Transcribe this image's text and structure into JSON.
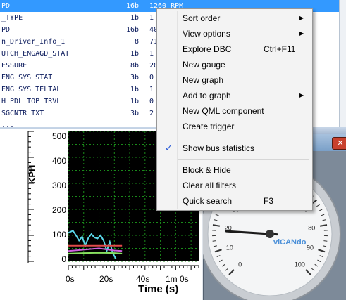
{
  "signals": [
    {
      "name": "PD",
      "len": "16b",
      "value": "1260 RPM",
      "selected": true
    },
    {
      "name": "_TYPE",
      "len": "1b",
      "value": "1"
    },
    {
      "name": "PD",
      "len": "16b",
      "value": "40"
    },
    {
      "name": "n_Driver_Info_1",
      "len": "8",
      "value": "71"
    },
    {
      "name": "UTCH_ENGAGD_STAT",
      "len": "1b",
      "value": "1"
    },
    {
      "name": "ESSURE",
      "len": "8b",
      "value": "20"
    },
    {
      "name": "ENG_SYS_STAT",
      "len": "3b",
      "value": "0"
    },
    {
      "name": "ENG_SYS_TELTAL",
      "len": "1b",
      "value": "1"
    },
    {
      "name": "H_PDL_TOP_TRVL",
      "len": "1b",
      "value": "0"
    },
    {
      "name": "SGCNTR_TXT",
      "len": "3b",
      "value": "2"
    },
    {
      "name": "...",
      "len": "",
      "value": ""
    }
  ],
  "plot": {
    "ylabel": "KPH",
    "xlabel": "Time (s)",
    "yticks": [
      "500",
      "400",
      "300",
      "200",
      "100",
      "0"
    ],
    "xticks": [
      "0s",
      "20s",
      "40s",
      "1m 0s"
    ]
  },
  "chart_data": {
    "type": "line",
    "xlabel": "Time (s)",
    "ylabel": "KPH",
    "ylim": [
      0,
      500
    ],
    "xlim": [
      0,
      85
    ],
    "series": [
      {
        "color": "#5ad6e8",
        "points": [
          [
            0,
            110
          ],
          [
            3,
            118
          ],
          [
            5,
            100
          ],
          [
            7,
            80
          ],
          [
            9,
            95
          ],
          [
            11,
            60
          ],
          [
            13,
            90
          ],
          [
            15,
            105
          ],
          [
            17,
            92
          ],
          [
            19,
            88
          ],
          [
            21,
            100
          ],
          [
            23,
            80
          ],
          [
            25,
            40
          ],
          [
            27,
            75
          ],
          [
            29,
            30
          ],
          [
            31,
            10
          ]
        ]
      },
      {
        "color": "#e04a4a",
        "points": [
          [
            0,
            60
          ],
          [
            10,
            60
          ],
          [
            20,
            60
          ],
          [
            30,
            60
          ],
          [
            35,
            60
          ]
        ]
      },
      {
        "color": "#d060e0",
        "points": [
          [
            0,
            40
          ],
          [
            10,
            45
          ],
          [
            20,
            50
          ],
          [
            30,
            42
          ],
          [
            35,
            40
          ]
        ]
      },
      {
        "color": "#88e060",
        "points": [
          [
            0,
            30
          ],
          [
            10,
            32
          ],
          [
            20,
            33
          ],
          [
            30,
            32
          ],
          [
            35,
            30
          ]
        ]
      }
    ]
  },
  "gauge": {
    "ticks": [
      "0",
      "10",
      "20",
      "30",
      "40",
      "50",
      "60",
      "70",
      "80",
      "90",
      "100"
    ],
    "value": 18,
    "max": 100,
    "logo": "viCANdo"
  },
  "menu": {
    "items": [
      {
        "label": "Sort order",
        "shortcut": "",
        "submenu": true,
        "checked": false
      },
      {
        "label": "View options",
        "shortcut": "",
        "submenu": true,
        "checked": false
      },
      {
        "label": "Explore DBC",
        "shortcut": "Ctrl+F11",
        "submenu": false,
        "checked": false
      },
      {
        "label": "New gauge",
        "shortcut": "",
        "submenu": false,
        "checked": false
      },
      {
        "label": "New graph",
        "shortcut": "",
        "submenu": false,
        "checked": false
      },
      {
        "label": "Add to graph",
        "shortcut": "",
        "submenu": true,
        "checked": false
      },
      {
        "label": "New QML component",
        "shortcut": "",
        "submenu": false,
        "checked": false
      },
      {
        "label": "Create trigger",
        "shortcut": "",
        "submenu": false,
        "checked": false
      },
      {
        "label": "Show bus statistics",
        "shortcut": "",
        "submenu": false,
        "checked": true
      },
      {
        "label": "Block & Hide",
        "shortcut": "",
        "submenu": false,
        "checked": false
      },
      {
        "label": "Clear all filters",
        "shortcut": "",
        "submenu": false,
        "checked": false
      },
      {
        "label": "Quick search",
        "shortcut": "F3",
        "submenu": false,
        "checked": false
      }
    ]
  },
  "colors": {
    "selection": "#3399ff",
    "plot_bg": "#000000",
    "grid": "#1a8a1a",
    "menu_check": "#2a5bd7"
  }
}
